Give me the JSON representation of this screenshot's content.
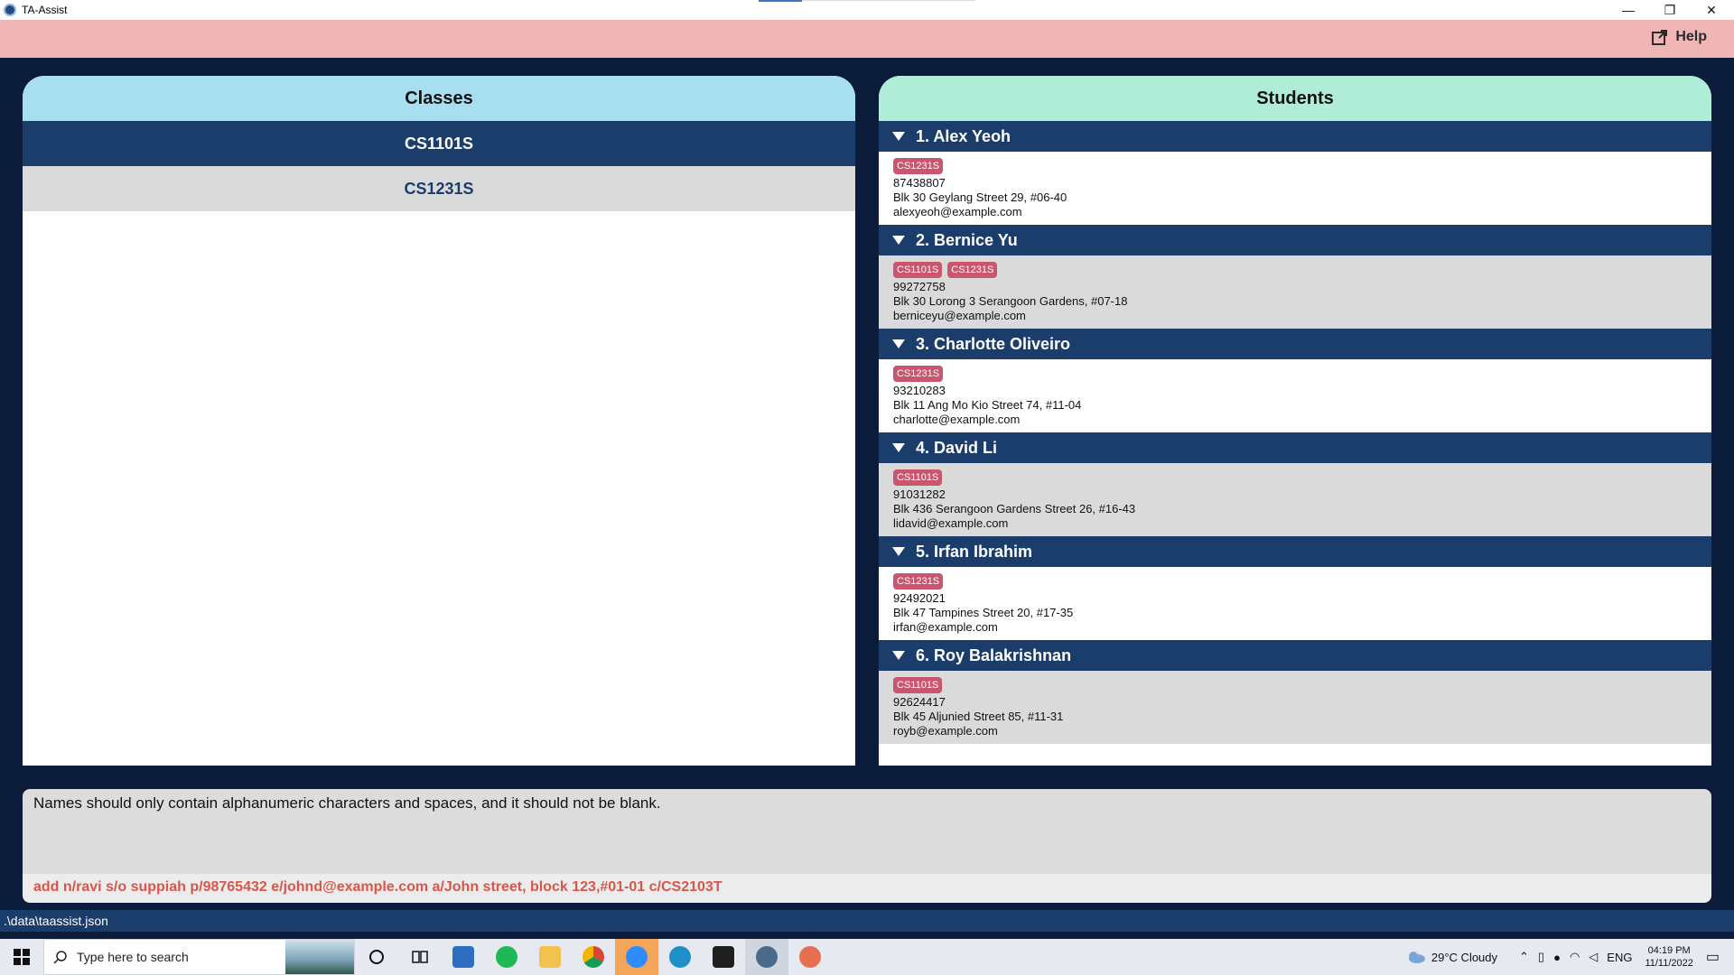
{
  "window": {
    "title": "TA-Assist"
  },
  "menu": {
    "help_label": "Help"
  },
  "classes_panel": {
    "title": "Classes",
    "items": [
      {
        "label": "CS1101S",
        "selected": true
      },
      {
        "label": "CS1231S",
        "selected": false
      }
    ]
  },
  "students_panel": {
    "title": "Students",
    "students": [
      {
        "header": "1. Alex Yeoh",
        "tags": [
          "CS1231S"
        ],
        "phone": "87438807",
        "address": "Blk 30 Geylang Street 29, #06-40",
        "email": "alexyeoh@example.com"
      },
      {
        "header": "2. Bernice Yu",
        "tags": [
          "CS1101S",
          "CS1231S"
        ],
        "phone": "99272758",
        "address": "Blk 30 Lorong 3 Serangoon Gardens, #07-18",
        "email": "berniceyu@example.com"
      },
      {
        "header": "3. Charlotte Oliveiro",
        "tags": [
          "CS1231S"
        ],
        "phone": "93210283",
        "address": "Blk 11 Ang Mo Kio Street 74, #11-04",
        "email": "charlotte@example.com"
      },
      {
        "header": "4. David Li",
        "tags": [
          "CS1101S"
        ],
        "phone": "91031282",
        "address": "Blk 436 Serangoon Gardens Street 26, #16-43",
        "email": "lidavid@example.com"
      },
      {
        "header": "5. Irfan Ibrahim",
        "tags": [
          "CS1231S"
        ],
        "phone": "92492021",
        "address": "Blk 47 Tampines Street 20, #17-35",
        "email": "irfan@example.com"
      },
      {
        "header": "6. Roy Balakrishnan",
        "tags": [
          "CS1101S"
        ],
        "phone": "92624417",
        "address": "Blk 45 Aljunied Street 85, #11-31",
        "email": "royb@example.com"
      }
    ]
  },
  "result": {
    "text": "Names should only contain alphanumeric characters and spaces, and it should not be blank."
  },
  "command": {
    "value": "add n/ravi s/o suppiah p/98765432 e/johnd@example.com a/John street, block 123,#01-01 c/CS2103T"
  },
  "status": {
    "path": ".\\data\\taassist.json"
  },
  "taskbar": {
    "search_placeholder": "Type here to search",
    "weather": "29°C  Cloudy",
    "lang": "ENG",
    "time": "04:19 PM",
    "date": "11/11/2022"
  },
  "colors": {
    "accent": "#1b3d6b",
    "tag": "#c9566e",
    "menubar": "#f0b6b6",
    "error_text": "#d9564a"
  }
}
